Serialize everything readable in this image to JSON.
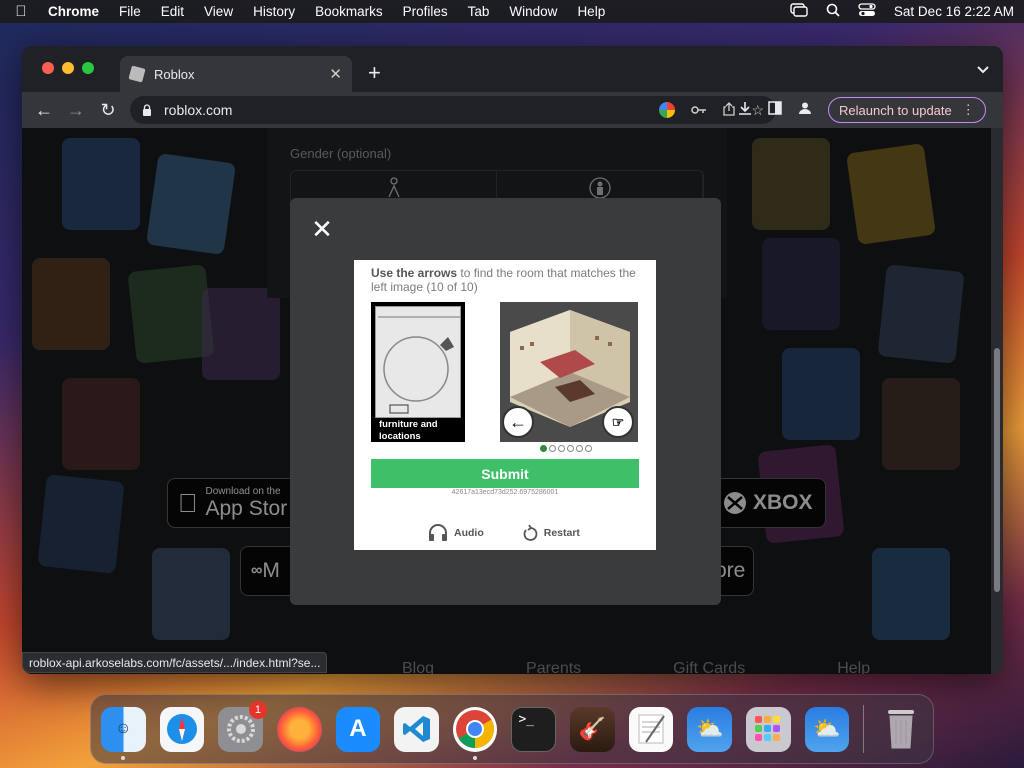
{
  "menubar": {
    "app": "Chrome",
    "items": [
      "File",
      "Edit",
      "View",
      "History",
      "Bookmarks",
      "Profiles",
      "Tab",
      "Window",
      "Help"
    ],
    "datetime": "Sat Dec 16  2:22 AM"
  },
  "browser": {
    "tab_title": "Roblox",
    "url": "roblox.com",
    "relaunch_label": "Relaunch to update",
    "status_url": "roblox-api.arkoselabs.com/fc/assets/.../index.html?se..."
  },
  "page": {
    "gender_label": "Gender (optional)",
    "app_store": {
      "small": "Download on the",
      "big": "App Stor"
    },
    "xbox_label": "XBOX",
    "ms_partial": "M",
    "store_partial": "ore",
    "footer_links": [
      "Blog",
      "Parents",
      "Gift Cards",
      "Help"
    ]
  },
  "captcha": {
    "instruction_bold": "Use the arrows",
    "instruction_rest": " to find the room that matches the left image (10 of 10)",
    "left_caption": "furniture and locations",
    "submit_label": "Submit",
    "session_id": "42617a13ecd73d252.6975286001",
    "audio_label": "Audio",
    "restart_label": "Restart",
    "progress": {
      "current": 1,
      "total": 6
    }
  },
  "dock": {
    "apps": [
      "Finder",
      "Safari",
      "System Settings",
      "Firefox",
      "App Store",
      "Visual Studio Code",
      "Google Chrome",
      "Terminal",
      "GarageBand",
      "TextEdit",
      "Weather",
      "Launchpad",
      "Weather",
      "Trash"
    ],
    "settings_badge": "1"
  }
}
